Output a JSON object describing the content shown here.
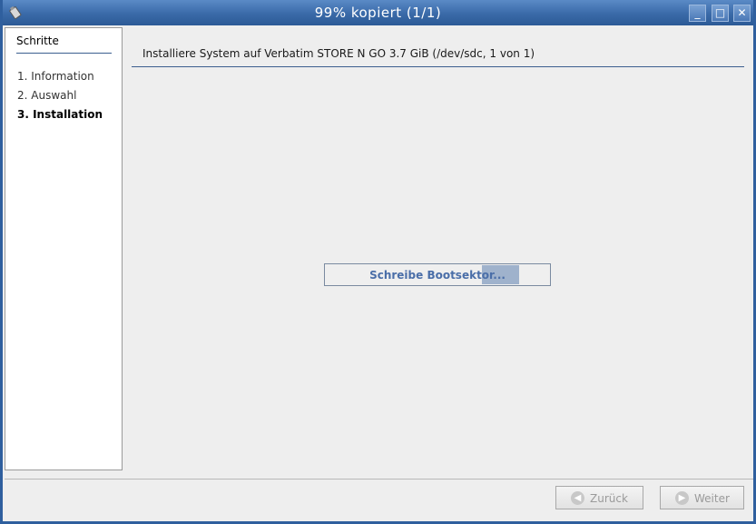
{
  "window": {
    "title": "99% kopiert (1/1)",
    "minimize_glyph": "_",
    "maximize_glyph": "□",
    "close_glyph": "✕",
    "app_icon": "usb-stick-icon"
  },
  "sidebar": {
    "title": "Schritte",
    "items": [
      {
        "label": "1.  Information",
        "active": false
      },
      {
        "label": "2.  Auswahl",
        "active": false
      },
      {
        "label": "3.  Installation",
        "active": true
      }
    ]
  },
  "main": {
    "heading": "Installiere System auf Verbatim STORE N GO 3.7 GiB (/dev/sdc, 1 von 1)",
    "progress": {
      "text": "Schreibe Bootsektor...",
      "indeterminate": true
    }
  },
  "buttons": {
    "back": {
      "label": "Zurück",
      "icon": "back-arrow-icon",
      "enabled": false
    },
    "next": {
      "label": "Weiter",
      "icon": "forward-arrow-icon",
      "enabled": false
    }
  }
}
